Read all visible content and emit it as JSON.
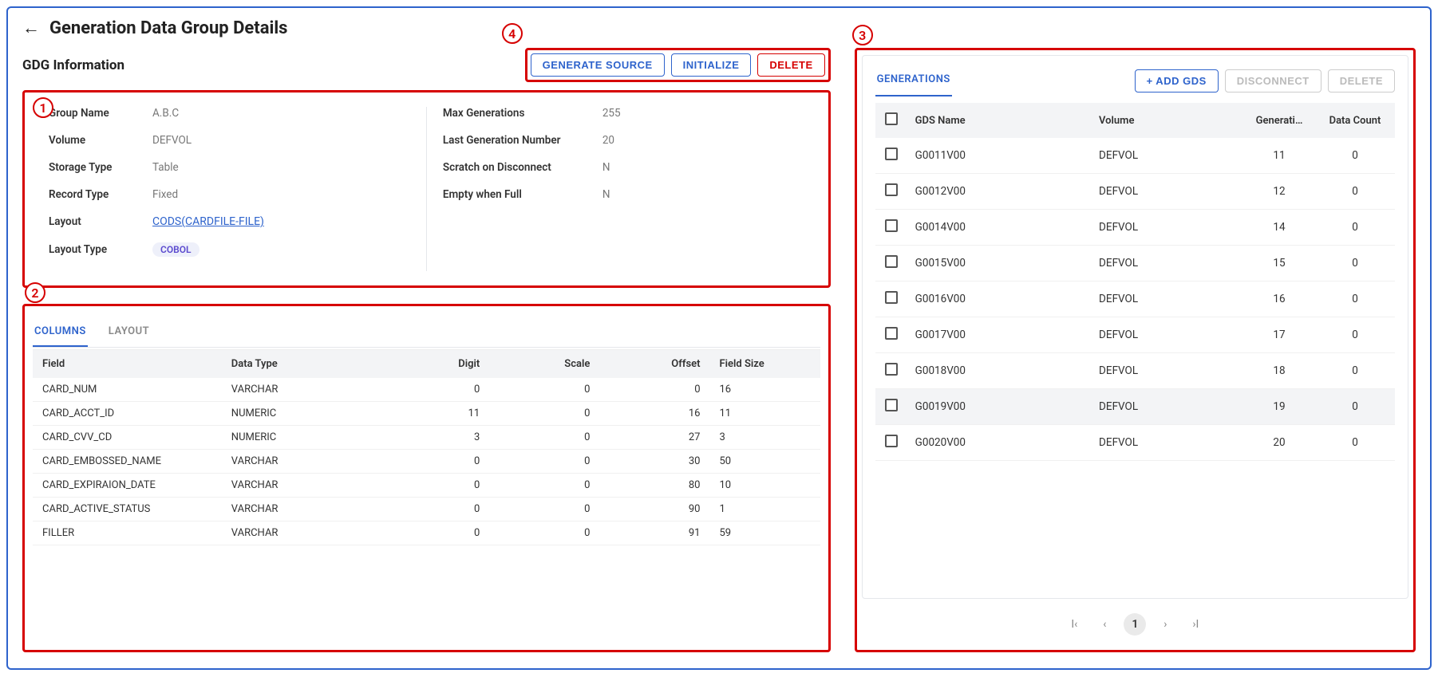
{
  "header": {
    "title": "Generation Data Group Details",
    "section_title": "GDG Information"
  },
  "actions": {
    "generate_source": "GENERATE SOURCE",
    "initialize": "INITIALIZE",
    "delete": "DELETE"
  },
  "callouts": {
    "c1": "1",
    "c2": "2",
    "c3": "3",
    "c4": "4"
  },
  "info_left": {
    "group_name_label": "Group Name",
    "group_name": "A.B.C",
    "volume_label": "Volume",
    "volume": "DEFVOL",
    "storage_type_label": "Storage Type",
    "storage_type": "Table",
    "record_type_label": "Record Type",
    "record_type": "Fixed",
    "layout_label": "Layout",
    "layout_link": "CODS(CARDFILE-FILE)",
    "layout_type_label": "Layout Type",
    "layout_type_pill": "COBOL"
  },
  "info_right": {
    "max_gen_label": "Max Generations",
    "max_gen": "255",
    "last_gen_label": "Last Generation Number",
    "last_gen": "20",
    "scratch_label": "Scratch on Disconnect",
    "scratch": "N",
    "empty_label": "Empty when Full",
    "empty": "N"
  },
  "lower_tabs": {
    "columns": "COLUMNS",
    "layout": "LAYOUT"
  },
  "columns_table": {
    "headers": {
      "field": "Field",
      "dtype": "Data Type",
      "digit": "Digit",
      "scale": "Scale",
      "offset": "Offset",
      "fsize": "Field Size"
    },
    "rows": [
      {
        "field": "CARD_NUM",
        "dtype": "VARCHAR",
        "digit": "0",
        "scale": "0",
        "offset": "0",
        "fsize": "16"
      },
      {
        "field": "CARD_ACCT_ID",
        "dtype": "NUMERIC",
        "digit": "11",
        "scale": "0",
        "offset": "16",
        "fsize": "11"
      },
      {
        "field": "CARD_CVV_CD",
        "dtype": "NUMERIC",
        "digit": "3",
        "scale": "0",
        "offset": "27",
        "fsize": "3"
      },
      {
        "field": "CARD_EMBOSSED_NAME",
        "dtype": "VARCHAR",
        "digit": "0",
        "scale": "0",
        "offset": "30",
        "fsize": "50"
      },
      {
        "field": "CARD_EXPIRAION_DATE",
        "dtype": "VARCHAR",
        "digit": "0",
        "scale": "0",
        "offset": "80",
        "fsize": "10"
      },
      {
        "field": "CARD_ACTIVE_STATUS",
        "dtype": "VARCHAR",
        "digit": "0",
        "scale": "0",
        "offset": "90",
        "fsize": "1"
      },
      {
        "field": "FILLER",
        "dtype": "VARCHAR",
        "digit": "0",
        "scale": "0",
        "offset": "91",
        "fsize": "59"
      }
    ]
  },
  "gen_panel": {
    "tab": "GENERATIONS",
    "add_btn": "+ ADD GDS",
    "disconnect_btn": "DISCONNECT",
    "delete_btn": "DELETE",
    "headers": {
      "name": "GDS Name",
      "vol": "Volume",
      "gen": "Generati…",
      "count": "Data Count"
    },
    "rows": [
      {
        "name": "G0011V00",
        "vol": "DEFVOL",
        "gen": "11",
        "count": "0",
        "hl": false
      },
      {
        "name": "G0012V00",
        "vol": "DEFVOL",
        "gen": "12",
        "count": "0",
        "hl": false
      },
      {
        "name": "G0014V00",
        "vol": "DEFVOL",
        "gen": "14",
        "count": "0",
        "hl": false
      },
      {
        "name": "G0015V00",
        "vol": "DEFVOL",
        "gen": "15",
        "count": "0",
        "hl": false
      },
      {
        "name": "G0016V00",
        "vol": "DEFVOL",
        "gen": "16",
        "count": "0",
        "hl": false
      },
      {
        "name": "G0017V00",
        "vol": "DEFVOL",
        "gen": "17",
        "count": "0",
        "hl": false
      },
      {
        "name": "G0018V00",
        "vol": "DEFVOL",
        "gen": "18",
        "count": "0",
        "hl": false
      },
      {
        "name": "G0019V00",
        "vol": "DEFVOL",
        "gen": "19",
        "count": "0",
        "hl": true
      },
      {
        "name": "G0020V00",
        "vol": "DEFVOL",
        "gen": "20",
        "count": "0",
        "hl": false
      }
    ],
    "page": "1"
  }
}
